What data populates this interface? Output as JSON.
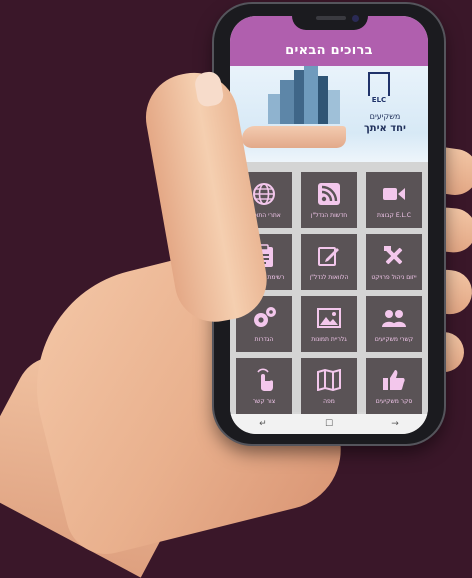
{
  "app": {
    "title": "ברוכים הבאים"
  },
  "banner": {
    "logo_text": "ELC",
    "tagline_line1": "משקיעים",
    "tagline_line2": "יחד איתך"
  },
  "tiles": [
    {
      "label": "E.L.C קבוצת",
      "icon": "video-camera-icon"
    },
    {
      "label": "חדשות הנדל\"ן",
      "icon": "rss-feed-icon"
    },
    {
      "label": "אתרי התוכנה",
      "icon": "globe-icon"
    },
    {
      "label": "ייזום ניהול פרויקט",
      "icon": "tools-icon"
    },
    {
      "label": "הלוואות לנדל\"ן",
      "icon": "edit-note-icon"
    },
    {
      "label": "רשימת המחירים",
      "icon": "clipboard-icon"
    },
    {
      "label": "קשרי משקיעים",
      "icon": "people-icon"
    },
    {
      "label": "גלריית תמונות",
      "icon": "image-icon"
    },
    {
      "label": "הגדרות",
      "icon": "gears-icon"
    },
    {
      "label": "סקר משקיעים",
      "icon": "thumbs-up-icon"
    },
    {
      "label": "מפה",
      "icon": "map-icon"
    },
    {
      "label": "צור קשר",
      "icon": "tap-icon"
    }
  ],
  "navbar": {
    "back": "↵",
    "home": "☐",
    "recent": "→"
  },
  "colors": {
    "header": "#b05fae",
    "tile_bg": "#5a5356",
    "icon_pink": "#f3c7ec",
    "background": "#3a1729"
  }
}
